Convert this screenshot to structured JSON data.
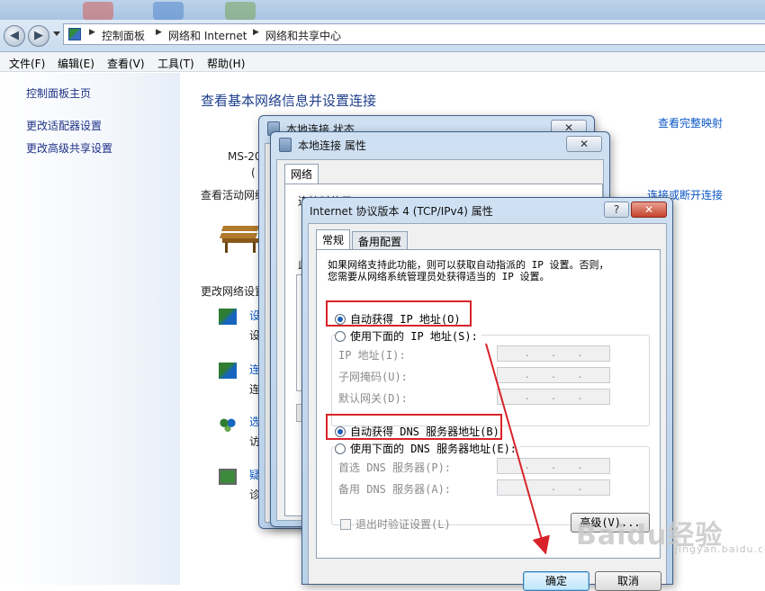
{
  "address_bar": {
    "crumbs": [
      "控制面板",
      "网络和 Internet",
      "网络和共享中心"
    ]
  },
  "menu": [
    "文件(F)",
    "编辑(E)",
    "查看(V)",
    "工具(T)",
    "帮助(H)"
  ],
  "sidebar": {
    "items": [
      "控制面板主页",
      "更改适配器设置",
      "更改高级共享设置"
    ]
  },
  "main": {
    "title": "查看基本网络信息并设置连接",
    "link_full_map": "查看完整映射",
    "computer_name": "MS-20",
    "paren": "(",
    "active_networks_label": "查看活动网络",
    "link_connect": "连接或断开连接",
    "change_settings_label": "更改网络设置",
    "task_initials": [
      "设",
      "设",
      "连",
      "连",
      "选",
      "访",
      "疑",
      "诊"
    ]
  },
  "status_dialog": {
    "title": "本地连接 状态"
  },
  "props_dialog": {
    "title": "本地连接 属性",
    "tab": "网络",
    "connect_using": "连接时使用:",
    "partial_label": "此"
  },
  "ipv4_dialog": {
    "title": "Internet 协议版本 4 (TCP/IPv4) 属性",
    "help": "?",
    "close": "✕",
    "tabs": [
      "常规",
      "备用配置"
    ],
    "desc_line1": "如果网络支持此功能，则可以获取自动指派的 IP 设置。否则，",
    "desc_line2": "您需要从网络系统管理员处获得适当的 IP 设置。",
    "auto_ip": "自动获得 IP 地址(O)",
    "manual_ip": "使用下面的 IP 地址(S):",
    "ip_label": "IP 地址(I):",
    "mask_label": "子网掩码(U):",
    "gateway_label": "默认网关(D):",
    "auto_dns": "自动获得 DNS 服务器地址(B)",
    "manual_dns": "使用下面的 DNS 服务器地址(E):",
    "dns1_label": "首选 DNS 服务器(P):",
    "dns2_label": "备用 DNS 服务器(A):",
    "validate_exit": "退出时验证设置(L)",
    "advanced": "高级(V)...",
    "ok": "确定",
    "cancel": "取消",
    "dot": "."
  },
  "watermark": {
    "brand": "Baidu经验",
    "url": "jingyan.baidu.com"
  }
}
